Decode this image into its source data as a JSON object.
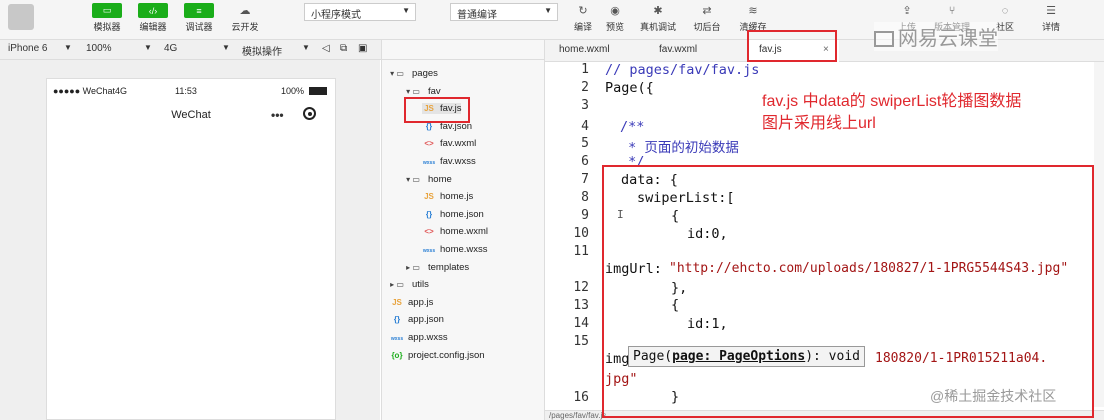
{
  "toolbar": {
    "simulator": "模拟器",
    "editor": "编辑器",
    "debugger": "调试器",
    "cloud": "云开发",
    "mode_select": "小程序模式",
    "compile_select": "普通编译",
    "compile": "编译",
    "preview": "预览",
    "realdebug": "真机调试",
    "background": "切后台",
    "clearcache": "清缓存",
    "upload": "上传",
    "version": "版本管理",
    "community": "社区",
    "details": "详情"
  },
  "secbar": {
    "device": "iPhone 6",
    "zoom": "100%",
    "network": "4G",
    "operation": "模拟操作"
  },
  "phone": {
    "carrier": "●●●●● WeChat4G",
    "time": "11:53",
    "battery": "100%",
    "title": "WeChat",
    "menu": "•••"
  },
  "tree": [
    {
      "label": "pages",
      "type": "folder",
      "level": 0
    },
    {
      "label": "fav",
      "type": "folder",
      "level": 1
    },
    {
      "label": "fav.js",
      "type": "js",
      "level": 2
    },
    {
      "label": "fav.json",
      "type": "json",
      "level": 2
    },
    {
      "label": "fav.wxml",
      "type": "wxml",
      "level": 2
    },
    {
      "label": "fav.wxss",
      "type": "wxss",
      "level": 2
    },
    {
      "label": "home",
      "type": "folder",
      "level": 1
    },
    {
      "label": "home.js",
      "type": "js",
      "level": 2
    },
    {
      "label": "home.json",
      "type": "json",
      "level": 2
    },
    {
      "label": "home.wxml",
      "type": "wxml",
      "level": 2
    },
    {
      "label": "home.wxss",
      "type": "wxss",
      "level": 2
    },
    {
      "label": "templates",
      "type": "folder-closed",
      "level": 1
    },
    {
      "label": "utils",
      "type": "folder-closed",
      "level": 0
    },
    {
      "label": "app.js",
      "type": "js",
      "level": 0
    },
    {
      "label": "app.json",
      "type": "json",
      "level": 0
    },
    {
      "label": "app.wxss",
      "type": "wxss",
      "level": 0
    },
    {
      "label": "project.config.json",
      "type": "config",
      "level": 0
    }
  ],
  "tabs": [
    "home.wxml",
    "fav.wxml",
    "fav.js"
  ],
  "line_numbers": [
    "1",
    "2",
    "3",
    "4",
    "5",
    "6",
    "7",
    "8",
    "9",
    "10",
    "11",
    "12",
    "13",
    "14",
    "15",
    "16"
  ],
  "code": {
    "l1": "// pages/fav/fav.js",
    "l2": "Page({",
    "l4": "/**",
    "l5": " * 页面的初始数据",
    "l6": " */",
    "l7": "data: {",
    "l8": "swiperList:[",
    "l9": "{",
    "l10": "id:0,",
    "l11a": "imgUrl:",
    "l11b": "\"http://ehcto.com/uploads/180827/1-1PRG5544S43.jpg\"",
    "l12": "},",
    "l13": "{",
    "l14": "id:1,",
    "l15a": "img",
    "l15b": "180820/1-1PR015211a04.",
    "l15c": "jpg\"",
    "l16": "}"
  },
  "tooltip": {
    "pre": "Page(",
    "param": "page: PageOptions",
    "post": "): void"
  },
  "annotation": {
    "line1": "fav.js 中data的 swiperList轮播图数据",
    "line2": "图片采用线上url"
  },
  "watermark_top": "网易云课堂",
  "watermark_bottom": "@稀土掘金技术社区",
  "statusbar": "/pages/fav/fav.js"
}
